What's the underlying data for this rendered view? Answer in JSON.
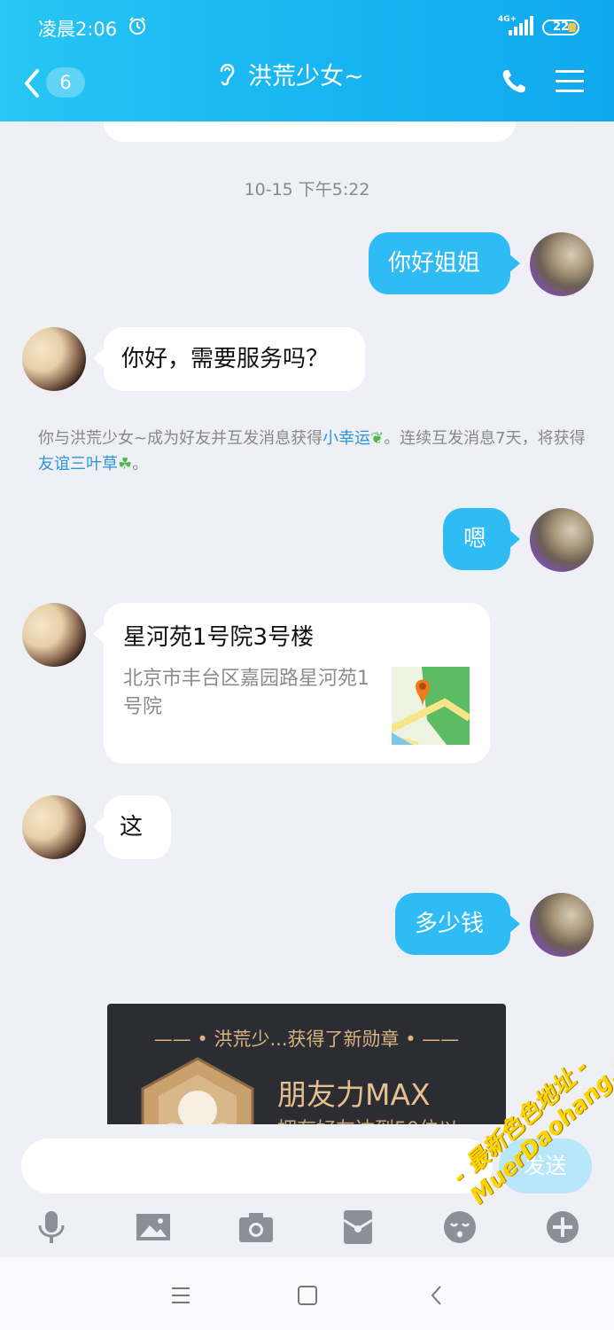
{
  "status_bar": {
    "time": "凌晨2:06",
    "network": "4G+",
    "battery": "22"
  },
  "header": {
    "unread_count": "6",
    "title": "洪荒少女~"
  },
  "timestamp": "10-15 下午5:22",
  "messages": {
    "m1": "你好姐姐",
    "m2": "你好，需要服务吗？",
    "m3": "嗯",
    "m4_title": "星河苑1号院3号楼",
    "m4_addr": "北京市丰台区嘉园路星河苑1号院",
    "m5": "这",
    "m6": "多少钱"
  },
  "system_notice": {
    "p1": "你与洪荒少女~成为好友并互发消息获得",
    "link1": "小幸运",
    "p2": "。连续互发消息7天，将获得",
    "link2": "友谊三叶草",
    "p3": "。"
  },
  "badge_card": {
    "top": "—— • 洪荒少...获得了新勋章 • ——",
    "main": "朋友力MAX",
    "sub": "拥有好友达到50位以"
  },
  "input": {
    "placeholder": "",
    "send_label": "发送"
  },
  "toolbar_icons": [
    "mic-icon",
    "image-icon",
    "camera-icon",
    "red-packet-icon",
    "emoji-icon",
    "plus-icon"
  ],
  "watermark": {
    "line1": "- 最新色色地址 -",
    "line2": "MuerDaohang.Com"
  },
  "colors": {
    "header": "#16b3f1",
    "outgoing_bubble": "#2fbcf4",
    "link": "#2e95d8",
    "background": "#eef0f6"
  }
}
